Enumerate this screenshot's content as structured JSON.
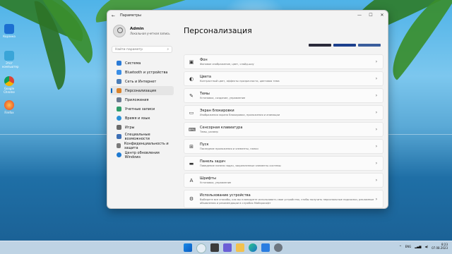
{
  "window": {
    "title": "Параметры",
    "minimize": "—",
    "maximize": "☐",
    "close": "✕"
  },
  "user": {
    "name": "Admin",
    "account_type": "Локальная учетная запись"
  },
  "search": {
    "placeholder": "Найти параметр"
  },
  "sidebar": {
    "items": [
      {
        "label": "Система",
        "color": "#2b7bd6"
      },
      {
        "label": "Bluetooth и устройства",
        "color": "#3a8ee6"
      },
      {
        "label": "Сеть и Интернет",
        "color": "#4a7db8"
      },
      {
        "label": "Персонализация",
        "color": "#d9822b"
      },
      {
        "label": "Приложения",
        "color": "#6b7a8f"
      },
      {
        "label": "Учетные записи",
        "color": "#2f9d6b"
      },
      {
        "label": "Время и язык",
        "color": "#2b8fd6"
      },
      {
        "label": "Игры",
        "color": "#6a6a6a"
      },
      {
        "label": "Специальные возможности",
        "color": "#3d6fb5"
      },
      {
        "label": "Конфиденциальность и защита",
        "color": "#7a7a7a"
      },
      {
        "label": "Центр обновления Windows",
        "color": "#1f7ad1"
      }
    ]
  },
  "main": {
    "title": "Персонализация",
    "cards": [
      {
        "icon": "▣",
        "title": "Фон",
        "sub": "Фоновое изображение, цвет, слайд-шоу"
      },
      {
        "icon": "◐",
        "title": "Цвета",
        "sub": "Контрастный цвет, эффекты прозрачности, цветовая тема"
      },
      {
        "icon": "✎",
        "title": "Темы",
        "sub": "Установка, создание, управление"
      },
      {
        "icon": "▭",
        "title": "Экран блокировки",
        "sub": "Изображения экрана блокировки, приложения и анимации"
      },
      {
        "icon": "⌨",
        "title": "Сенсорная клавиатура",
        "sub": "Темы, размер"
      },
      {
        "icon": "⊞",
        "title": "Пуск",
        "sub": "Последние приложения и элементы, папки"
      },
      {
        "icon": "▬",
        "title": "Панель задач",
        "sub": "Поведение панели задач, закрепленные элементы системы"
      },
      {
        "icon": "A",
        "title": "Шрифты",
        "sub": "Установка, управление"
      },
      {
        "icon": "⚙",
        "title": "Использование устройства",
        "sub": "Выберите все способы, как вы планируете использовать свое устройство, чтобы получить персональные подсказки, рекламные объявления и рекомендации в службах Майкрософт"
      }
    ],
    "chevron": "›"
  },
  "desktop": {
    "icons": [
      "Корзина",
      "Этот компьютер",
      "Google Chrome",
      "Firefox"
    ]
  },
  "taskbar": {
    "lang": "ENG",
    "time": "8:23",
    "date": "07.08.2023"
  },
  "colors": {
    "accent": "#0067c0"
  }
}
